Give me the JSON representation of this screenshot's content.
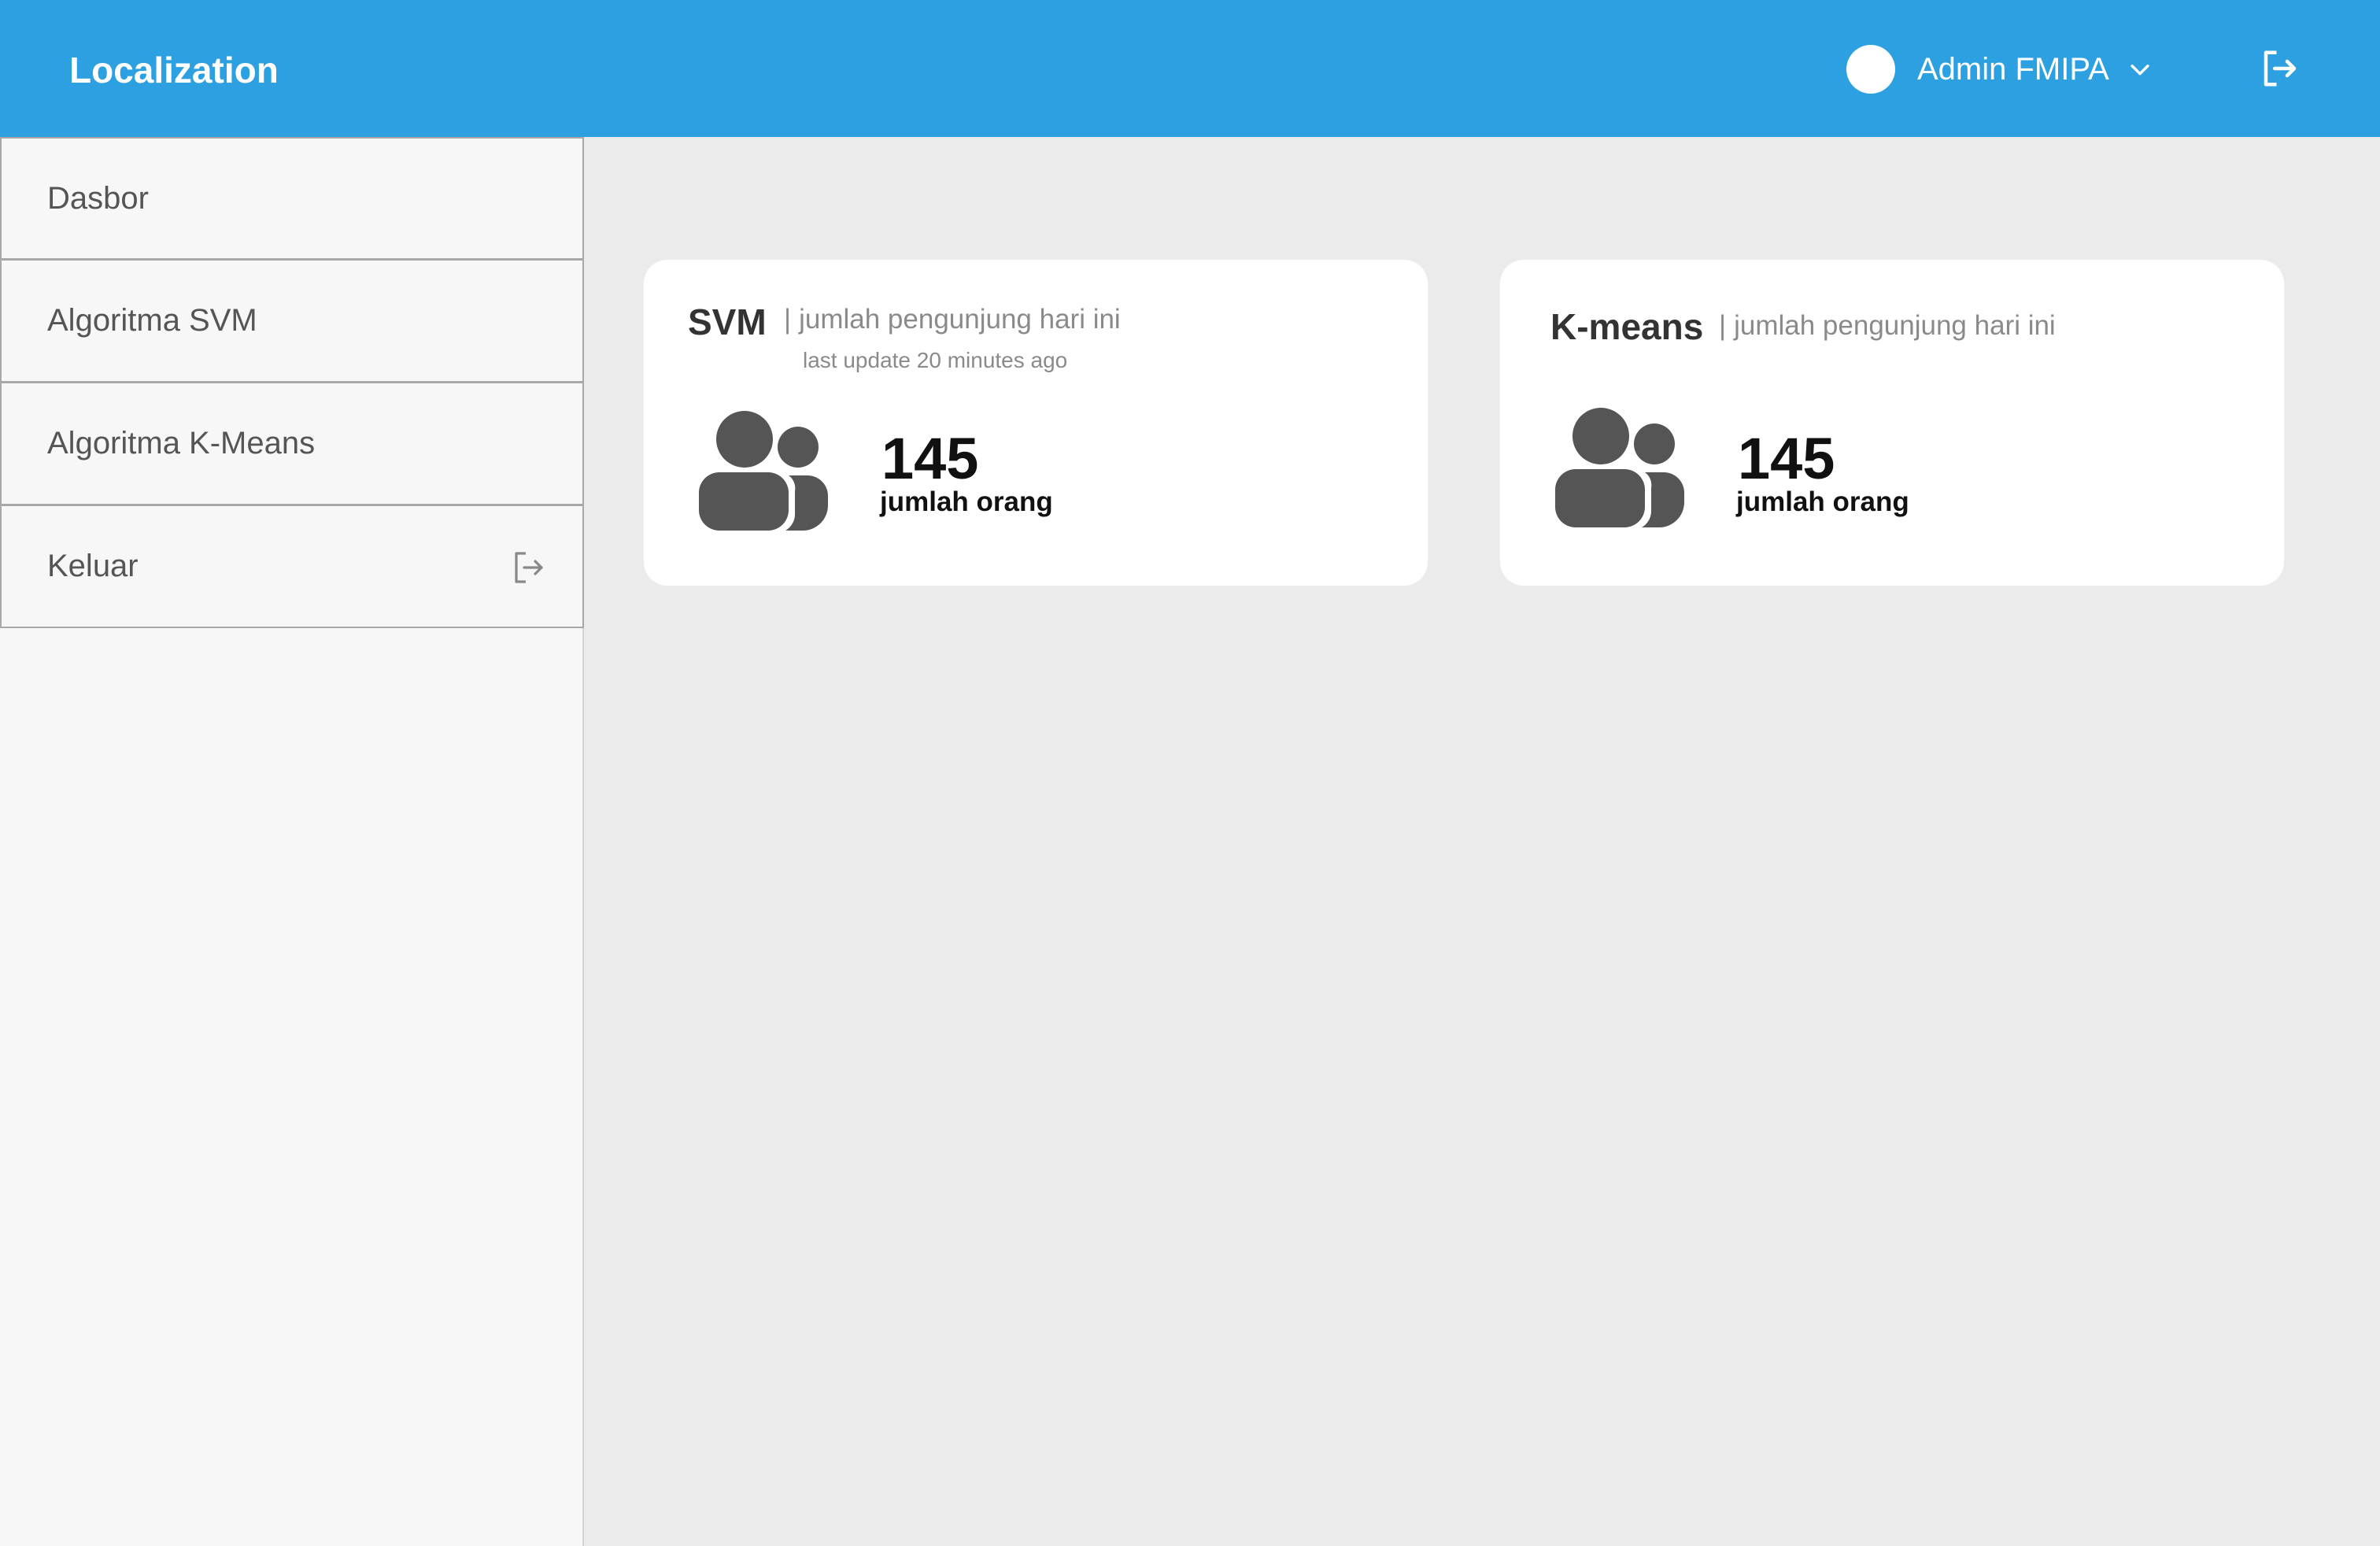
{
  "header": {
    "brand": "Localization",
    "user_name": "Admin FMIPA",
    "accent_color": "#2ca0e1"
  },
  "sidebar": {
    "items": [
      {
        "label": "Dasbor"
      },
      {
        "label": "Algoritma SVM"
      },
      {
        "label": "Algoritma K-Means"
      },
      {
        "label": "Keluar",
        "icon": "logout-icon"
      }
    ]
  },
  "cards": {
    "svm": {
      "title": "SVM",
      "subtitle": "jumlah pengunjung hari ini",
      "updated": "last update 20 minutes ago",
      "count": "145",
      "count_label": "jumlah orang",
      "icon": "people-icon"
    },
    "kmeans": {
      "title": "K-means",
      "subtitle": "jumlah pengunjung hari ini",
      "count": "145",
      "count_label": "jumlah orang",
      "icon": "people-icon"
    }
  },
  "separator": "|"
}
